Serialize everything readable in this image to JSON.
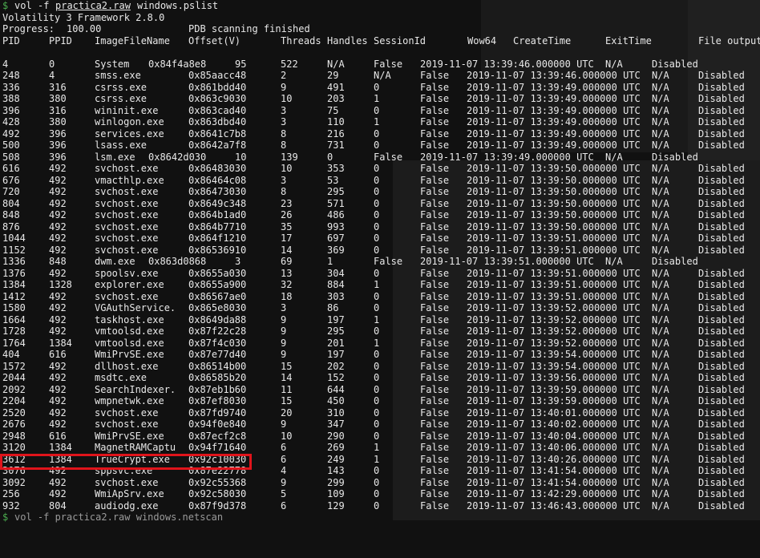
{
  "terminal": {
    "prompt_symbol": "$",
    "command_prog": "vol",
    "command_flag": "-f",
    "command_file": "practica2.raw",
    "command_plugin": "windows.pslist",
    "banner": "Volatility 3 Framework 2.8.0",
    "progress_label": "Progress:",
    "progress_value": "100.00",
    "progress_status": "PDB scanning finished",
    "next_command": "vol -f practica2.raw windows.netscan",
    "accent_color": "#e0141b"
  },
  "headers": [
    "PID",
    "PPID",
    "ImageFileName",
    "Offset(V)",
    "Threads",
    "Handles",
    "SessionId",
    "Wow64",
    "CreateTime",
    "ExitTime",
    "File output"
  ],
  "rows": [
    {
      "pid": "4",
      "ppid": "0",
      "name": "System",
      "offset": "0x84f4a8e8",
      "threads": "95",
      "handles": "522",
      "session": "N/A",
      "wow": "False",
      "create": "2019-11-07 13:39:46.000000 UTC",
      "exit": "N/A",
      "out": "Disabled",
      "shift": true
    },
    {
      "pid": "248",
      "ppid": "4",
      "name": "smss.exe",
      "offset": "0x85aacc48",
      "threads": "2",
      "handles": "29",
      "session": "N/A",
      "wow": "False",
      "create": "2019-11-07 13:39:46.000000 UTC",
      "exit": "N/A",
      "out": "Disabled"
    },
    {
      "pid": "336",
      "ppid": "316",
      "name": "csrss.exe",
      "offset": "0x861bdd40",
      "threads": "9",
      "handles": "491",
      "session": "0",
      "wow": "False",
      "create": "2019-11-07 13:39:49.000000 UTC",
      "exit": "N/A",
      "out": "Disabled"
    },
    {
      "pid": "388",
      "ppid": "380",
      "name": "csrss.exe",
      "offset": "0x863c9030",
      "threads": "10",
      "handles": "203",
      "session": "1",
      "wow": "False",
      "create": "2019-11-07 13:39:49.000000 UTC",
      "exit": "N/A",
      "out": "Disabled"
    },
    {
      "pid": "396",
      "ppid": "316",
      "name": "wininit.exe",
      "offset": "0x863cad40",
      "threads": "3",
      "handles": "75",
      "session": "0",
      "wow": "False",
      "create": "2019-11-07 13:39:49.000000 UTC",
      "exit": "N/A",
      "out": "Disabled"
    },
    {
      "pid": "428",
      "ppid": "380",
      "name": "winlogon.exe",
      "offset": "0x863dbd40",
      "threads": "3",
      "handles": "110",
      "session": "1",
      "wow": "False",
      "create": "2019-11-07 13:39:49.000000 UTC",
      "exit": "N/A",
      "out": "Disabled"
    },
    {
      "pid": "492",
      "ppid": "396",
      "name": "services.exe",
      "offset": "0x8641c7b8",
      "threads": "8",
      "handles": "216",
      "session": "0",
      "wow": "False",
      "create": "2019-11-07 13:39:49.000000 UTC",
      "exit": "N/A",
      "out": "Disabled"
    },
    {
      "pid": "500",
      "ppid": "396",
      "name": "lsass.exe",
      "offset": "0x8642a7f8",
      "threads": "8",
      "handles": "731",
      "session": "0",
      "wow": "False",
      "create": "2019-11-07 13:39:49.000000 UTC",
      "exit": "N/A",
      "out": "Disabled"
    },
    {
      "pid": "508",
      "ppid": "396",
      "name": "lsm.exe",
      "offset": "0x8642d030",
      "threads": "10",
      "handles": "139",
      "session": "0",
      "wow": "False",
      "create": "2019-11-07 13:39:49.000000 UTC",
      "exit": "N/A",
      "out": "Disabled",
      "shift": true
    },
    {
      "pid": "616",
      "ppid": "492",
      "name": "svchost.exe",
      "offset": "0x86483030",
      "threads": "10",
      "handles": "353",
      "session": "0",
      "wow": "False",
      "create": "2019-11-07 13:39:50.000000 UTC",
      "exit": "N/A",
      "out": "Disabled"
    },
    {
      "pid": "676",
      "ppid": "492",
      "name": "vmacthlp.exe",
      "offset": "0x86464c08",
      "threads": "3",
      "handles": "53",
      "session": "0",
      "wow": "False",
      "create": "2019-11-07 13:39:50.000000 UTC",
      "exit": "N/A",
      "out": "Disabled"
    },
    {
      "pid": "720",
      "ppid": "492",
      "name": "svchost.exe",
      "offset": "0x86473030",
      "threads": "8",
      "handles": "295",
      "session": "0",
      "wow": "False",
      "create": "2019-11-07 13:39:50.000000 UTC",
      "exit": "N/A",
      "out": "Disabled"
    },
    {
      "pid": "804",
      "ppid": "492",
      "name": "svchost.exe",
      "offset": "0x8649c348",
      "threads": "23",
      "handles": "571",
      "session": "0",
      "wow": "False",
      "create": "2019-11-07 13:39:50.000000 UTC",
      "exit": "N/A",
      "out": "Disabled"
    },
    {
      "pid": "848",
      "ppid": "492",
      "name": "svchost.exe",
      "offset": "0x864b1ad0",
      "threads": "26",
      "handles": "486",
      "session": "0",
      "wow": "False",
      "create": "2019-11-07 13:39:50.000000 UTC",
      "exit": "N/A",
      "out": "Disabled"
    },
    {
      "pid": "876",
      "ppid": "492",
      "name": "svchost.exe",
      "offset": "0x864b7710",
      "threads": "35",
      "handles": "993",
      "session": "0",
      "wow": "False",
      "create": "2019-11-07 13:39:50.000000 UTC",
      "exit": "N/A",
      "out": "Disabled"
    },
    {
      "pid": "1044",
      "ppid": "492",
      "name": "svchost.exe",
      "offset": "0x864f1210",
      "threads": "17",
      "handles": "697",
      "session": "0",
      "wow": "False",
      "create": "2019-11-07 13:39:51.000000 UTC",
      "exit": "N/A",
      "out": "Disabled"
    },
    {
      "pid": "1152",
      "ppid": "492",
      "name": "svchost.exe",
      "offset": "0x86536910",
      "threads": "14",
      "handles": "369",
      "session": "0",
      "wow": "False",
      "create": "2019-11-07 13:39:51.000000 UTC",
      "exit": "N/A",
      "out": "Disabled"
    },
    {
      "pid": "1336",
      "ppid": "848",
      "name": "dwm.exe",
      "offset": "0x863d0868",
      "threads": "3",
      "handles": "69",
      "session": "1",
      "wow": "False",
      "create": "2019-11-07 13:39:51.000000 UTC",
      "exit": "N/A",
      "out": "Disabled",
      "shift": true
    },
    {
      "pid": "1376",
      "ppid": "492",
      "name": "spoolsv.exe",
      "offset": "0x8655a030",
      "threads": "13",
      "handles": "304",
      "session": "0",
      "wow": "False",
      "create": "2019-11-07 13:39:51.000000 UTC",
      "exit": "N/A",
      "out": "Disabled"
    },
    {
      "pid": "1384",
      "ppid": "1328",
      "name": "explorer.exe",
      "offset": "0x8655a900",
      "threads": "32",
      "handles": "884",
      "session": "1",
      "wow": "False",
      "create": "2019-11-07 13:39:51.000000 UTC",
      "exit": "N/A",
      "out": "Disabled"
    },
    {
      "pid": "1412",
      "ppid": "492",
      "name": "svchost.exe",
      "offset": "0x86567ae0",
      "threads": "18",
      "handles": "303",
      "session": "0",
      "wow": "False",
      "create": "2019-11-07 13:39:51.000000 UTC",
      "exit": "N/A",
      "out": "Disabled"
    },
    {
      "pid": "1580",
      "ppid": "492",
      "name": "VGAuthService.",
      "offset": "0x865e8030",
      "threads": "3",
      "handles": "86",
      "session": "0",
      "wow": "False",
      "create": "2019-11-07 13:39:52.000000 UTC",
      "exit": "N/A",
      "out": "Disabled"
    },
    {
      "pid": "1664",
      "ppid": "492",
      "name": "taskhost.exe",
      "offset": "0x8649da88",
      "threads": "9",
      "handles": "197",
      "session": "1",
      "wow": "False",
      "create": "2019-11-07 13:39:52.000000 UTC",
      "exit": "N/A",
      "out": "Disabled"
    },
    {
      "pid": "1728",
      "ppid": "492",
      "name": "vmtoolsd.exe",
      "offset": "0x87f22c28",
      "threads": "9",
      "handles": "295",
      "session": "0",
      "wow": "False",
      "create": "2019-11-07 13:39:52.000000 UTC",
      "exit": "N/A",
      "out": "Disabled"
    },
    {
      "pid": "1764",
      "ppid": "1384",
      "name": "vmtoolsd.exe",
      "offset": "0x87f4c030",
      "threads": "9",
      "handles": "201",
      "session": "1",
      "wow": "False",
      "create": "2019-11-07 13:39:52.000000 UTC",
      "exit": "N/A",
      "out": "Disabled"
    },
    {
      "pid": "404",
      "ppid": "616",
      "name": "WmiPrvSE.exe",
      "offset": "0x87e77d40",
      "threads": "9",
      "handles": "197",
      "session": "0",
      "wow": "False",
      "create": "2019-11-07 13:39:54.000000 UTC",
      "exit": "N/A",
      "out": "Disabled"
    },
    {
      "pid": "1572",
      "ppid": "492",
      "name": "dllhost.exe",
      "offset": "0x86514b00",
      "threads": "15",
      "handles": "202",
      "session": "0",
      "wow": "False",
      "create": "2019-11-07 13:39:54.000000 UTC",
      "exit": "N/A",
      "out": "Disabled"
    },
    {
      "pid": "2044",
      "ppid": "492",
      "name": "msdtc.exe",
      "offset": "0x86585b20",
      "threads": "14",
      "handles": "152",
      "session": "0",
      "wow": "False",
      "create": "2019-11-07 13:39:56.000000 UTC",
      "exit": "N/A",
      "out": "Disabled"
    },
    {
      "pid": "2092",
      "ppid": "492",
      "name": "SearchIndexer.",
      "offset": "0x87eb1b60",
      "threads": "11",
      "handles": "644",
      "session": "0",
      "wow": "False",
      "create": "2019-11-07 13:39:59.000000 UTC",
      "exit": "N/A",
      "out": "Disabled"
    },
    {
      "pid": "2204",
      "ppid": "492",
      "name": "wmpnetwk.exe",
      "offset": "0x87ef8030",
      "threads": "15",
      "handles": "450",
      "session": "0",
      "wow": "False",
      "create": "2019-11-07 13:39:59.000000 UTC",
      "exit": "N/A",
      "out": "Disabled"
    },
    {
      "pid": "2520",
      "ppid": "492",
      "name": "svchost.exe",
      "offset": "0x87fd9740",
      "threads": "20",
      "handles": "310",
      "session": "0",
      "wow": "False",
      "create": "2019-11-07 13:40:01.000000 UTC",
      "exit": "N/A",
      "out": "Disabled"
    },
    {
      "pid": "2676",
      "ppid": "492",
      "name": "svchost.exe",
      "offset": "0x94f0e840",
      "threads": "9",
      "handles": "347",
      "session": "0",
      "wow": "False",
      "create": "2019-11-07 13:40:02.000000 UTC",
      "exit": "N/A",
      "out": "Disabled"
    },
    {
      "pid": "2948",
      "ppid": "616",
      "name": "WmiPrvSE.exe",
      "offset": "0x87ecf2c8",
      "threads": "10",
      "handles": "290",
      "session": "0",
      "wow": "False",
      "create": "2019-11-07 13:40:04.000000 UTC",
      "exit": "N/A",
      "out": "Disabled"
    },
    {
      "pid": "3120",
      "ppid": "1384",
      "name": "MagnetRAMCaptu",
      "offset": "0x94f71640",
      "threads": "6",
      "handles": "269",
      "session": "1",
      "wow": "False",
      "create": "2019-11-07 13:40:06.000000 UTC",
      "exit": "N/A",
      "out": "Disabled"
    },
    {
      "pid": "3612",
      "ppid": "1384",
      "name": "TrueCrypt.exe",
      "offset": "0x92c10030",
      "threads": "6",
      "handles": "249",
      "session": "1",
      "wow": "False",
      "create": "2019-11-07 13:40:26.000000 UTC",
      "exit": "N/A",
      "out": "Disabled",
      "highlight": true
    },
    {
      "pid": "3076",
      "ppid": "492",
      "name": "sppsvc.exe",
      "offset": "0x87e22778",
      "threads": "4",
      "handles": "143",
      "session": "0",
      "wow": "False",
      "create": "2019-11-07 13:41:54.000000 UTC",
      "exit": "N/A",
      "out": "Disabled"
    },
    {
      "pid": "3092",
      "ppid": "492",
      "name": "svchost.exe",
      "offset": "0x92c55368",
      "threads": "9",
      "handles": "299",
      "session": "0",
      "wow": "False",
      "create": "2019-11-07 13:41:54.000000 UTC",
      "exit": "N/A",
      "out": "Disabled"
    },
    {
      "pid": "256",
      "ppid": "492",
      "name": "WmiApSrv.exe",
      "offset": "0x92c58030",
      "threads": "5",
      "handles": "109",
      "session": "0",
      "wow": "False",
      "create": "2019-11-07 13:42:29.000000 UTC",
      "exit": "N/A",
      "out": "Disabled"
    },
    {
      "pid": "932",
      "ppid": "804",
      "name": "audiodg.exe",
      "offset": "0x87f9d378",
      "threads": "6",
      "handles": "129",
      "session": "0",
      "wow": "False",
      "create": "2019-11-07 13:46:43.000000 UTC",
      "exit": "N/A",
      "out": "Disabled"
    }
  ]
}
